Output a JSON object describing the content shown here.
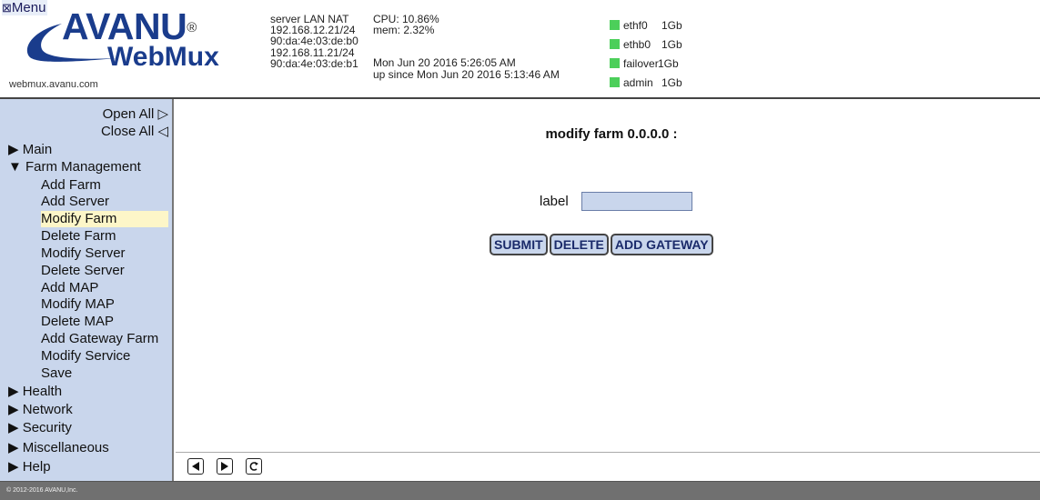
{
  "header": {
    "menu_label": "Menu",
    "menu_icon": "⊠",
    "brand_top": "AVANU",
    "brand_reg": "®",
    "brand_bottom": "WebMux",
    "site": "webmux.avanu.com",
    "server": [
      "server LAN NAT",
      "192.168.12.21/24",
      "90:da:4e:03:de:b0",
      "192.168.11.21/24",
      "90:da:4e:03:de:b1"
    ],
    "cpu": "CPU: 10.86%",
    "mem": "mem: 2.32%",
    "date": "Mon Jun 20 2016 5:26:05 AM",
    "uptime": "up since Mon Jun 20 2016 5:13:46 AM",
    "interfaces": [
      {
        "name": "ethf0",
        "speed": "1Gb"
      },
      {
        "name": "ethb0",
        "speed": "1Gb"
      },
      {
        "name": "failover",
        "speed": "1Gb"
      },
      {
        "name": "admin",
        "speed": "1Gb"
      }
    ],
    "status_color": "#4ccf5a"
  },
  "sidebar": {
    "open_all": "Open All ▷",
    "close_all": "Close All ◁",
    "main": "▶ Main",
    "farm_management": "▼ Farm Management",
    "farm_items": [
      "Add Farm",
      "Add Server",
      "Modify Farm",
      "Delete Farm",
      "Modify Server",
      "Delete Server",
      "Add MAP",
      "Modify MAP",
      "Delete MAP",
      "Add Gateway Farm",
      "Modify Service",
      "Save"
    ],
    "active_item": "Modify Farm",
    "health": "▶ Health",
    "network": "▶ Network",
    "security": "▶ Security",
    "miscellaneous": "▶ Miscellaneous",
    "help": "▶ Help"
  },
  "main": {
    "title": "modify farm 0.0.0.0 :",
    "label_text": "label",
    "label_value": "",
    "submit": "SUBMIT",
    "delete": "DELETE",
    "add_gateway": "ADD GATEWAY"
  },
  "footer": {
    "copyright": "© 2012-2016 AVANU,Inc."
  },
  "colors": {
    "sidebar_bg": "#c9d6ec",
    "active_bg": "#fdf6c8",
    "brand": "#1a3c8c",
    "footer_bg": "#707070"
  }
}
